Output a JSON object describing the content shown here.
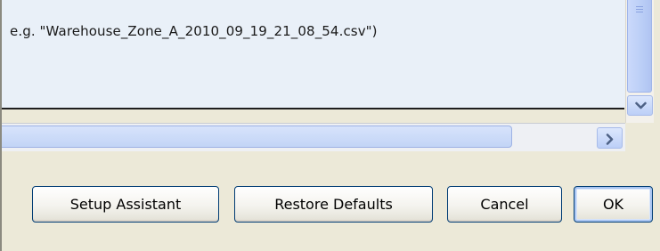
{
  "text_area": {
    "hint": "e.g. \"Warehouse_Zone_A_2010_09_19_21_08_54.csv\")"
  },
  "buttons": {
    "setup_assistant": "Setup Assistant",
    "restore_defaults": "Restore Defaults",
    "cancel": "Cancel",
    "ok": "OK"
  },
  "icons": {
    "scroll_down": "chevron-down-icon",
    "scroll_right": "chevron-right-icon"
  },
  "colors": {
    "dialog_background": "#ece9d8",
    "text_area_background": "#e9f0f8",
    "button_border": "#003c74",
    "scrollbar_blue": "#bdd0f7"
  }
}
